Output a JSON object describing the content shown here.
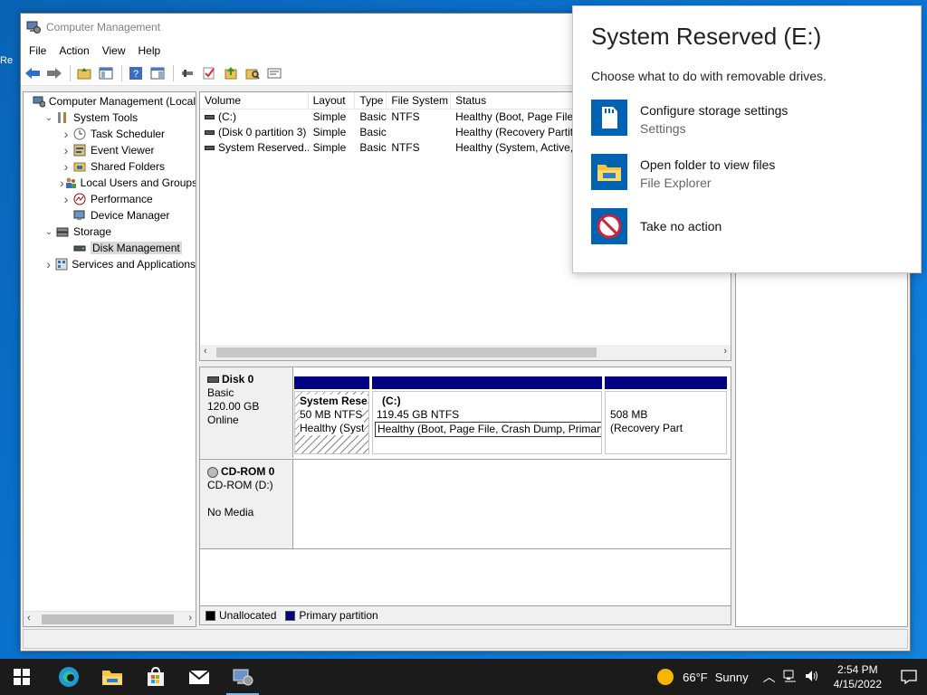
{
  "window": {
    "title": "Computer Management",
    "menus": [
      "File",
      "Action",
      "View",
      "Help"
    ]
  },
  "desktop": {
    "edge_text": "Re"
  },
  "tree": {
    "items": [
      {
        "label": "Computer Management (Local",
        "level": 0,
        "exp": "",
        "icon": "computer-management-icon"
      },
      {
        "label": "System Tools",
        "level": 1,
        "exp": "v",
        "icon": "system-tools-icon"
      },
      {
        "label": "Task Scheduler",
        "level": 2,
        "exp": ">",
        "icon": "task-scheduler-icon"
      },
      {
        "label": "Event Viewer",
        "level": 2,
        "exp": ">",
        "icon": "event-viewer-icon"
      },
      {
        "label": "Shared Folders",
        "level": 2,
        "exp": ">",
        "icon": "shared-folders-icon"
      },
      {
        "label": "Local Users and Groups",
        "level": 2,
        "exp": ">",
        "icon": "local-users-icon"
      },
      {
        "label": "Performance",
        "level": 2,
        "exp": ">",
        "icon": "performance-icon"
      },
      {
        "label": "Device Manager",
        "level": 2,
        "exp": "",
        "icon": "device-manager-icon"
      },
      {
        "label": "Storage",
        "level": 1,
        "exp": "v",
        "icon": "storage-icon"
      },
      {
        "label": "Disk Management",
        "level": 2,
        "exp": "",
        "icon": "disk-management-icon",
        "selected": true
      },
      {
        "label": "Services and Applications",
        "level": 1,
        "exp": ">",
        "icon": "services-icon"
      }
    ]
  },
  "volumes": {
    "columns": [
      "Volume",
      "Layout",
      "Type",
      "File System",
      "Status"
    ],
    "rows": [
      [
        "(C:)",
        "Simple",
        "Basic",
        "NTFS",
        "Healthy (Boot, Page File,"
      ],
      [
        "(Disk 0 partition 3)",
        "Simple",
        "Basic",
        "",
        "Healthy (Recovery Partit"
      ],
      [
        "System Reserved...",
        "Simple",
        "Basic",
        "NTFS",
        "Healthy (System, Active,"
      ]
    ]
  },
  "disks": {
    "disk0": {
      "name": "Disk 0",
      "type": "Basic",
      "size": "120.00 GB",
      "state": "Online",
      "partitions": [
        {
          "name": "System Rese",
          "size": "50 MB NTFS",
          "status": "Healthy (Syst"
        },
        {
          "name": "(C:)",
          "size": "119.45 GB NTFS",
          "status": "Healthy (Boot, Page File, Crash Dump, Primary Partition)"
        },
        {
          "name": "",
          "size": "508 MB",
          "status": "(Recovery Part"
        }
      ]
    },
    "cdrom": {
      "name": "CD-ROM 0",
      "type": "CD-ROM (D:)",
      "state": "No Media"
    },
    "legend": [
      "Unallocated",
      "Primary partition"
    ]
  },
  "notification": {
    "title": "System Reserved (E:)",
    "subtitle": "Choose what to do with removable drives.",
    "options": [
      {
        "label": "Configure storage settings",
        "sub": "Settings",
        "icon": "sd-card-icon"
      },
      {
        "label": "Open folder to view files",
        "sub": "File Explorer",
        "icon": "folder-icon"
      },
      {
        "label": "Take no action",
        "sub": "",
        "icon": "no-action-icon"
      }
    ]
  },
  "taskbar": {
    "weather_temp": "66°F",
    "weather_cond": "Sunny",
    "time": "2:54 PM",
    "date": "4/15/2022"
  },
  "colors": {
    "primary_partition": "#000080",
    "unallocated": "#000000",
    "notif_icon_bg": "#0063b1"
  }
}
